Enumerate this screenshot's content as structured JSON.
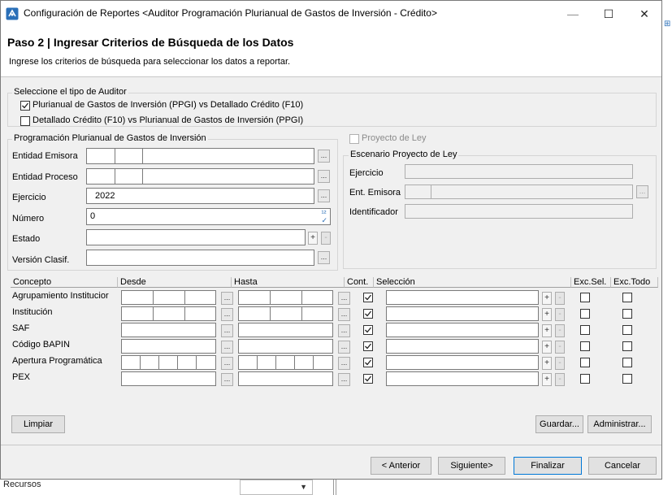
{
  "window": {
    "title": "Configuración de Reportes <Auditor Programación Plurianual de Gastos de Inversión - Crédito>",
    "minimize_glyph": "—",
    "maximize_glyph": "☐",
    "close_glyph": "✕"
  },
  "header": {
    "step_title": "Paso 2 | Ingresar Criterios de Búsqueda de los Datos",
    "description": "Ingrese los criterios de búsqueda para seleccionar los datos a reportar."
  },
  "auditor_type": {
    "legend": "Seleccione el tipo de Auditor",
    "options": [
      {
        "label": "Plurianual de Gastos de Inversión (PPGI) vs Detallado Crédito (F10)",
        "checked": true
      },
      {
        "label": "Detallado Crédito (F10) vs Plurianual de Gastos de Inversión (PPGI)",
        "checked": false
      }
    ]
  },
  "ppgi": {
    "legend": "Programación Plurianual de Gastos de Inversión",
    "entidad_emisora_label": "Entidad Emisora",
    "entidad_proceso_label": "Entidad Proceso",
    "ejercicio_label": "Ejercicio",
    "ejercicio_value": "2022",
    "numero_label": "Número",
    "numero_value": "0",
    "estado_label": "Estado",
    "version_label": "Versión Clasif.",
    "dots": "...",
    "plus": "+",
    "minus": "-"
  },
  "proyecto_ley": {
    "checkbox_label": "Proyecto de Ley",
    "legend": "Escenario Proyecto de Ley",
    "ejercicio_label": "Ejercicio",
    "ent_emisora_label": "Ent. Emisora",
    "identificador_label": "Identificador"
  },
  "grid": {
    "headers": {
      "concepto": "Concepto",
      "desde": "Desde",
      "hasta": "Hasta",
      "cont": "Cont.",
      "seleccion": "Selección",
      "exc_sel": "Exc.Sel.",
      "exc_todo": "Exc.Todo"
    },
    "rows": [
      {
        "concepto": "Agrupamiento Institucior",
        "cont": true,
        "exc_sel": false,
        "exc_todo": false
      },
      {
        "concepto": "Institución",
        "cont": true,
        "exc_sel": false,
        "exc_todo": false
      },
      {
        "concepto": "SAF",
        "cont": true,
        "exc_sel": false,
        "exc_todo": false
      },
      {
        "concepto": "Código BAPIN",
        "cont": true,
        "exc_sel": false,
        "exc_todo": false
      },
      {
        "concepto": "Apertura Programática",
        "cont": true,
        "exc_sel": false,
        "exc_todo": false
      },
      {
        "concepto": "PEX",
        "cont": true,
        "exc_sel": false,
        "exc_todo": false
      }
    ]
  },
  "buttons": {
    "limpiar": "Limpiar",
    "guardar": "Guardar...",
    "administrar": "Administrar...",
    "anterior": "< Anterior",
    "siguiente": "Siguiente>",
    "finalizar": "Finalizar",
    "cancelar": "Cancelar"
  },
  "background": {
    "recursos_text": "Recursos"
  },
  "colors": {
    "accent": "#0078d7",
    "window_bg": "#f0f0f0",
    "icon_blue": "#2a6fb8"
  }
}
